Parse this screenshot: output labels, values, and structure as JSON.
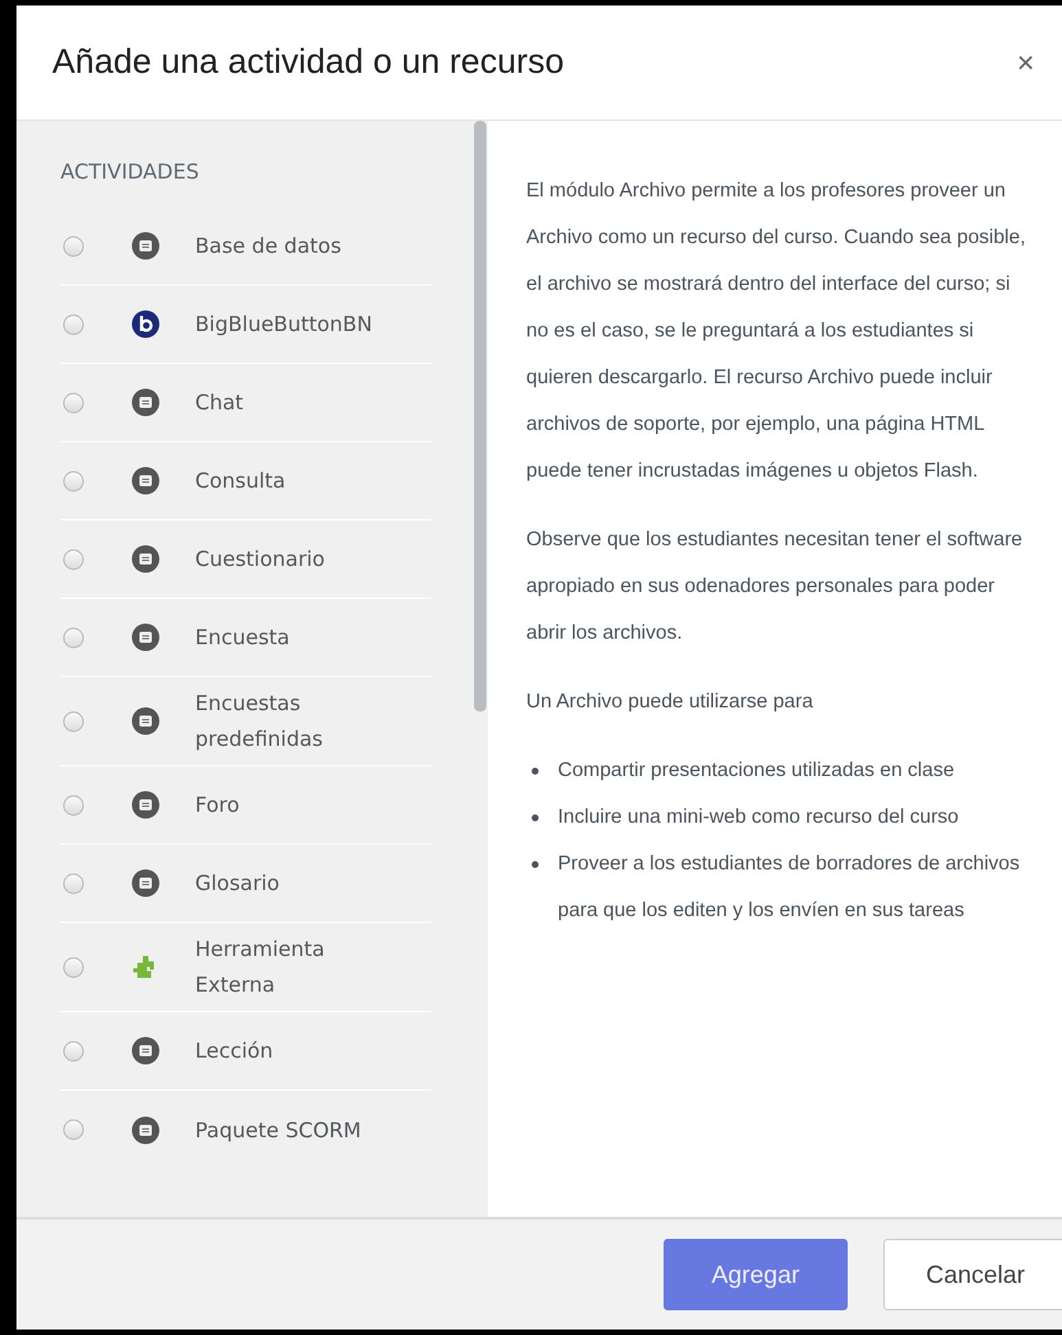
{
  "dialog": {
    "title": "Añade una actividad o un recurso",
    "close": "×"
  },
  "section_heading": "ACTIVIDADES",
  "activities": [
    {
      "label": "Base de datos",
      "kind": "module",
      "selected": false
    },
    {
      "label": "BigBlueButtonBN",
      "kind": "conference",
      "selected": false
    },
    {
      "label": "Chat",
      "kind": "module",
      "selected": false
    },
    {
      "label": "Consulta",
      "kind": "module",
      "selected": false
    },
    {
      "label": "Cuestionario",
      "kind": "module",
      "selected": false
    },
    {
      "label": "Encuesta",
      "kind": "module",
      "selected": false
    },
    {
      "label": "Encuestas predefinidas",
      "kind": "module",
      "selected": false
    },
    {
      "label": "Foro",
      "kind": "module",
      "selected": false
    },
    {
      "label": "Glosario",
      "kind": "module",
      "selected": false
    },
    {
      "label": "Herramienta Externa",
      "kind": "plugin",
      "selected": false
    },
    {
      "label": "Lección",
      "kind": "module",
      "selected": false
    },
    {
      "label": "Paquete SCORM",
      "kind": "module",
      "selected": false
    }
  ],
  "description": {
    "paragraphs": [
      "El módulo Archivo permite a los profesores proveer un Archivo como un recurso del curso. Cuando sea posible, el archivo se mostrará dentro del interface del curso; si no es el caso, se le preguntará a los estudiantes si quieren descargarlo. El recurso Archivo puede incluir archivos de soporte, por ejemplo, una página HTML puede tener incrustadas imágenes u objetos Flash.",
      "Observe que los estudiantes necesitan tener el software apropiado en sus odenadores personales para poder abrir los archivos.",
      "Un Archivo puede utilizarse para"
    ],
    "bullets": [
      "Compartir presentaciones utilizadas en clase",
      "Incluire una mini-web como recurso del curso",
      "Proveer a los estudiantes de borradores de archivos para que los editen y los envíen en sus tareas"
    ]
  },
  "buttons": [
    {
      "label": "Agregar",
      "kind": "primary"
    },
    {
      "label": "Cancelar",
      "kind": "secondary"
    }
  ]
}
